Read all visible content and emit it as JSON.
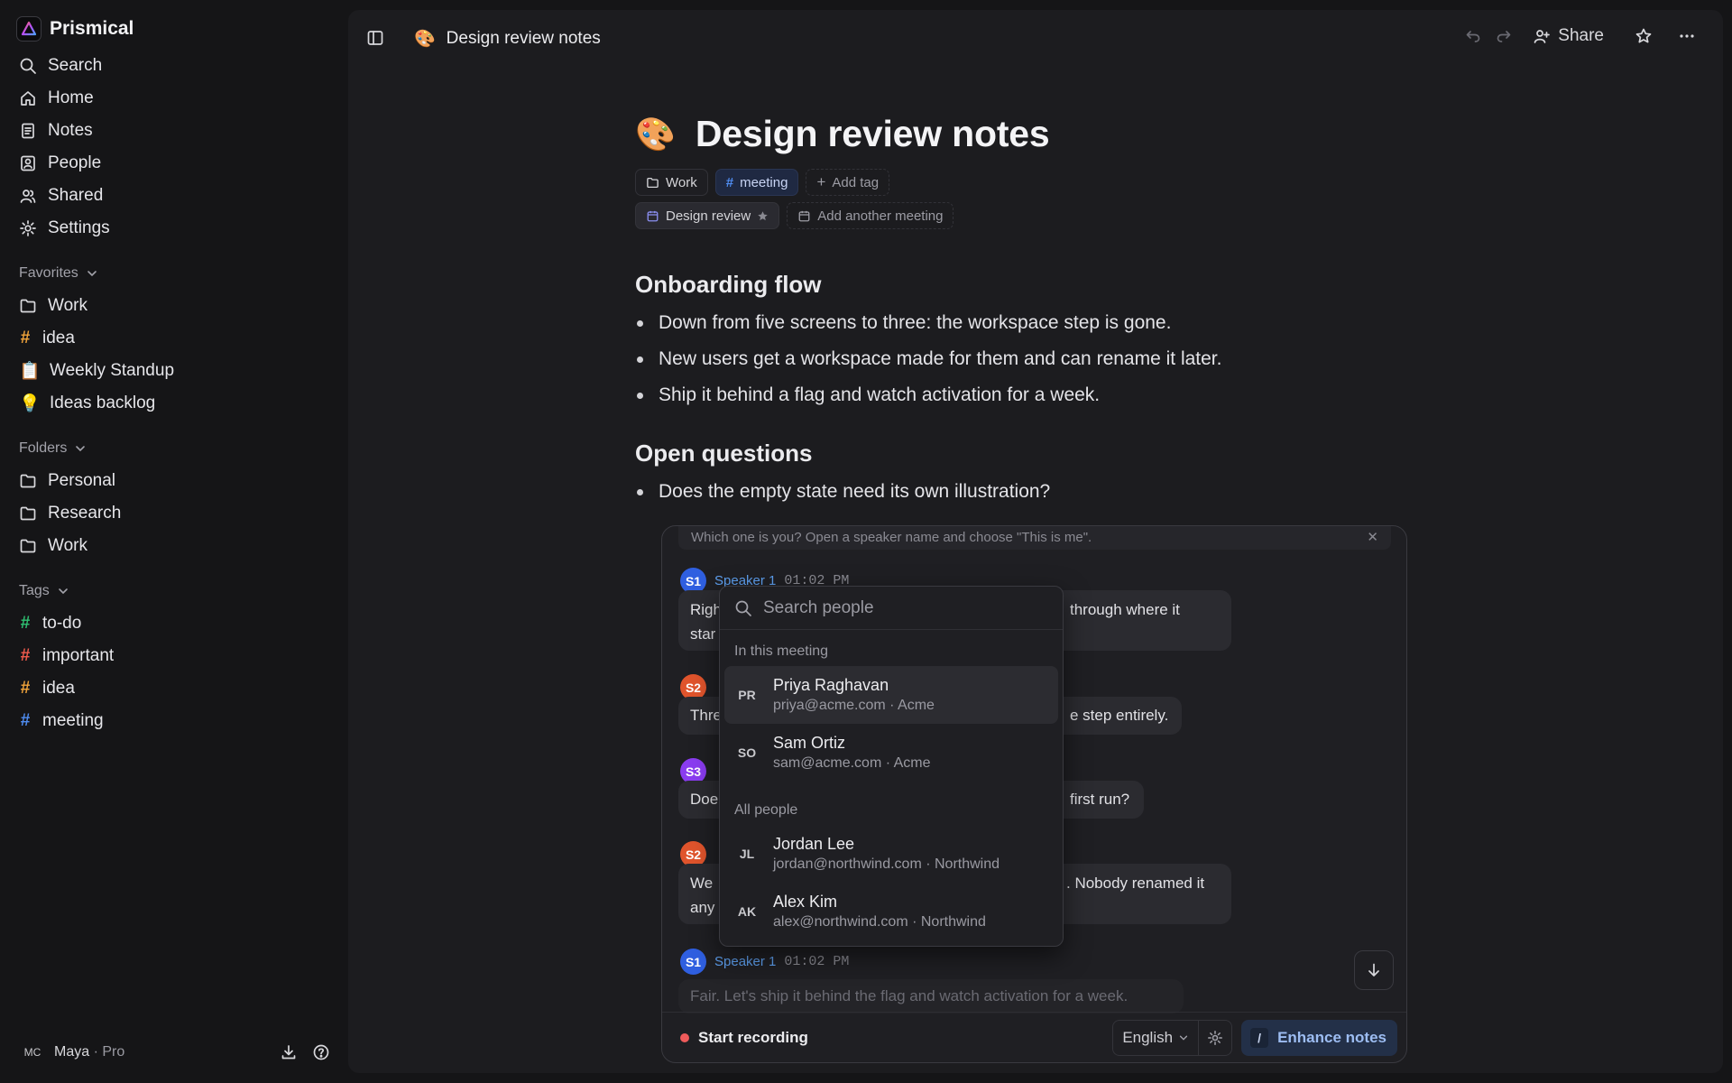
{
  "app": {
    "name": "Prismical"
  },
  "sidebar": {
    "nav": [
      {
        "label": "Search",
        "icon": "search-icon"
      },
      {
        "label": "Home",
        "icon": "home-icon"
      },
      {
        "label": "Notes",
        "icon": "notes-icon"
      },
      {
        "label": "People",
        "icon": "person-card-icon"
      },
      {
        "label": "Shared",
        "icon": "users-icon"
      },
      {
        "label": "Settings",
        "icon": "gear-icon"
      }
    ],
    "favorites": {
      "title": "Favorites",
      "items": [
        {
          "label": "Work",
          "icon": "folder-icon"
        },
        {
          "label": "idea",
          "icon": "hash-icon",
          "color": "#f0a33a"
        },
        {
          "label": "Weekly Standup",
          "icon": "clipboard-emoji",
          "emoji": "📋"
        },
        {
          "label": "Ideas backlog",
          "icon": "lightbulb-emoji",
          "emoji": "💡"
        }
      ]
    },
    "folders": {
      "title": "Folders",
      "items": [
        {
          "label": "Personal"
        },
        {
          "label": "Research"
        },
        {
          "label": "Work"
        }
      ]
    },
    "tags": {
      "title": "Tags",
      "items": [
        {
          "label": "to-do",
          "color": "#2fbf71"
        },
        {
          "label": "important",
          "color": "#ef5b4c"
        },
        {
          "label": "idea",
          "color": "#f0a33a"
        },
        {
          "label": "meeting",
          "color": "#4f8cf0"
        }
      ]
    },
    "footer": {
      "initials": "MC",
      "user": "Maya",
      "plan": " · Pro"
    }
  },
  "topbar": {
    "emoji": "🎨",
    "title": "Design review notes",
    "share_label": "Share"
  },
  "doc": {
    "emoji": "🎨",
    "title": "Design review notes",
    "folder_chip": "Work",
    "tag_chip": "meeting",
    "tag_color": "#4f8cf0",
    "add_tag": "Add tag",
    "meeting_chip": "Design review",
    "add_meeting": "Add another meeting",
    "sections": [
      {
        "heading": "Onboarding flow",
        "bullets": [
          "Down from five screens to three: the workspace step is gone.",
          "New users get a workspace made for them and can rename it later.",
          "Ship it behind a flag and watch activation for a week."
        ]
      },
      {
        "heading": "Open questions",
        "bullets": [
          "Does the empty state need its own illustration?"
        ]
      }
    ]
  },
  "transcript": {
    "banner": "Which one is you? Open a speaker name and choose \"This is me\".",
    "segments": [
      {
        "initials": "S1",
        "color": "#2f5fe0",
        "speaker": "Speaker 1",
        "time": "01:02 PM",
        "left": "Righ",
        "left2": "star",
        "right": "through where it"
      },
      {
        "initials": "S2",
        "color": "#e0542c",
        "left": "Thre",
        "right": "e step entirely."
      },
      {
        "initials": "S3",
        "color": "#8a3cf0",
        "left": "Doe",
        "right": "first run?"
      },
      {
        "initials": "S2",
        "color": "#e0542c",
        "left": "We",
        "left2": "any",
        "right": ". Nobody renamed it"
      },
      {
        "initials": "S1",
        "color": "#2f5fe0",
        "speaker": "Speaker 1",
        "time": "01:02 PM",
        "text": "Fair. Let's ship it behind the flag and watch activation for a week."
      }
    ],
    "footer": {
      "record_label": "Start recording",
      "language": "English",
      "enhance_label": "Enhance notes",
      "slash": "/"
    }
  },
  "people_dropdown": {
    "placeholder": "Search people",
    "groups": [
      {
        "title": "In this meeting",
        "people": [
          {
            "initials": "PR",
            "name": "Priya Raghavan",
            "sub": "priya@acme.com · Acme"
          },
          {
            "initials": "SO",
            "name": "Sam Ortiz",
            "sub": "sam@acme.com · Acme"
          }
        ]
      },
      {
        "title": "All people",
        "people": [
          {
            "initials": "JL",
            "name": "Jordan Lee",
            "sub": "jordan@northwind.com · Northwind"
          },
          {
            "initials": "AK",
            "name": "Alex Kim",
            "sub": "alex@northwind.com · Northwind"
          }
        ]
      }
    ]
  },
  "colors": {
    "accent": "#5ea0f0",
    "recording": "#ef5b5b",
    "enhance_bg": "#233048"
  }
}
